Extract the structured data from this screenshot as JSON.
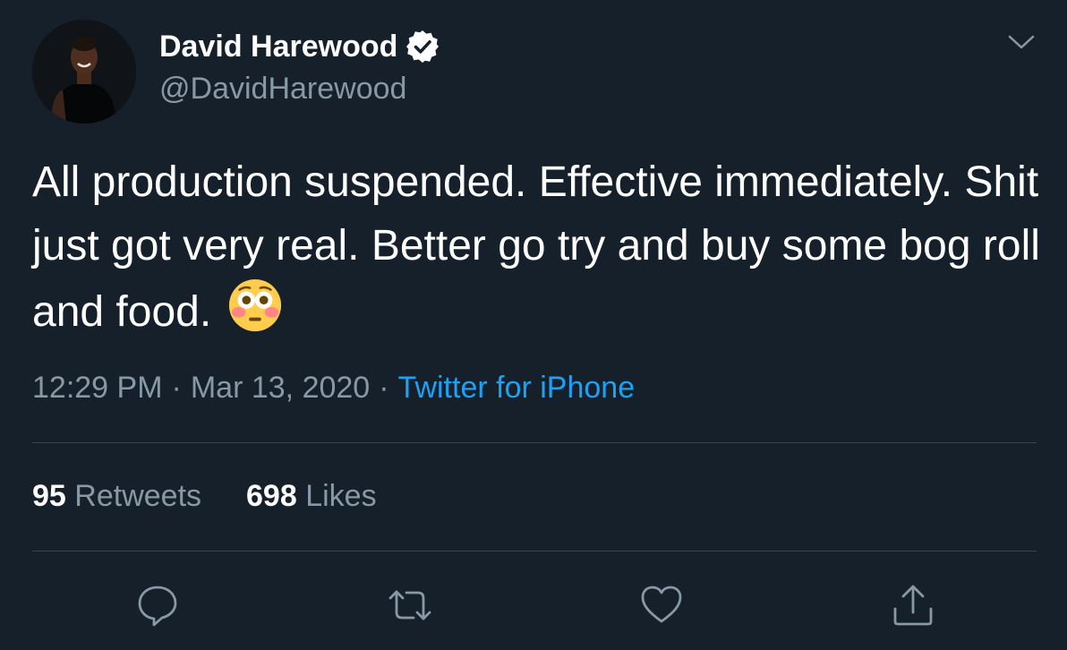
{
  "author": {
    "name": "David Harewood",
    "handle": "@DavidHarewood",
    "verified": true
  },
  "tweet": {
    "text": "All production suspended. Effective immediately. Shit just got very real. Better go try and buy some bog roll and food.",
    "emoji": "flushed-face"
  },
  "meta": {
    "time": "12:29 PM",
    "separator": "·",
    "date": "Mar 13, 2020",
    "source": "Twitter for iPhone"
  },
  "stats": {
    "retweets_count": "95",
    "retweets_label": "Retweets",
    "likes_count": "698",
    "likes_label": "Likes"
  },
  "icons": {
    "menu": "chevron-down-icon",
    "reply": "reply-icon",
    "retweet": "retweet-icon",
    "like": "heart-icon",
    "share": "share-icon"
  },
  "colors": {
    "background": "#15202b",
    "primary_text": "#ffffff",
    "secondary_text": "#8899a6",
    "link": "#1da1f2",
    "divider": "#38444d"
  }
}
